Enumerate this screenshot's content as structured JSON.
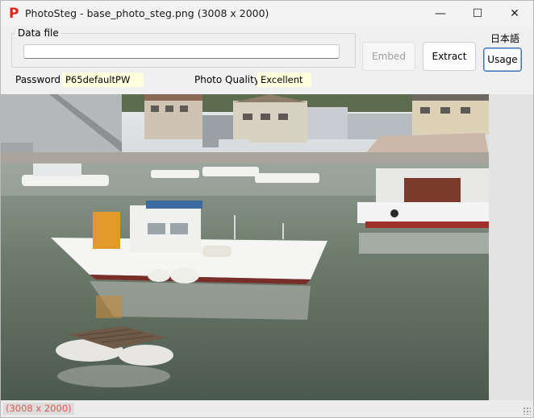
{
  "window": {
    "app_icon_glyph": "P",
    "title": "PhotoSteg - base_photo_steg.png (3008 x 2000)",
    "minimize_glyph": "—",
    "maximize_glyph": "☐",
    "close_glyph": "✕"
  },
  "datafile": {
    "group_label": "Data file",
    "value": ""
  },
  "buttons": {
    "embed": "Embed",
    "extract": "Extract",
    "usage": "Usage",
    "language": "日本語"
  },
  "settings": {
    "password_label": "Password",
    "password_value": "P65defaultPW",
    "quality_label": "Photo Quality",
    "quality_value": "Excellent"
  },
  "status": {
    "dimensions": "(3008 x 2000)"
  },
  "colors": {
    "app_icon": "#e2231a",
    "field_bg": "#ffffe0",
    "status_text": "#e0584c",
    "usage_border": "#3d6fb8"
  }
}
